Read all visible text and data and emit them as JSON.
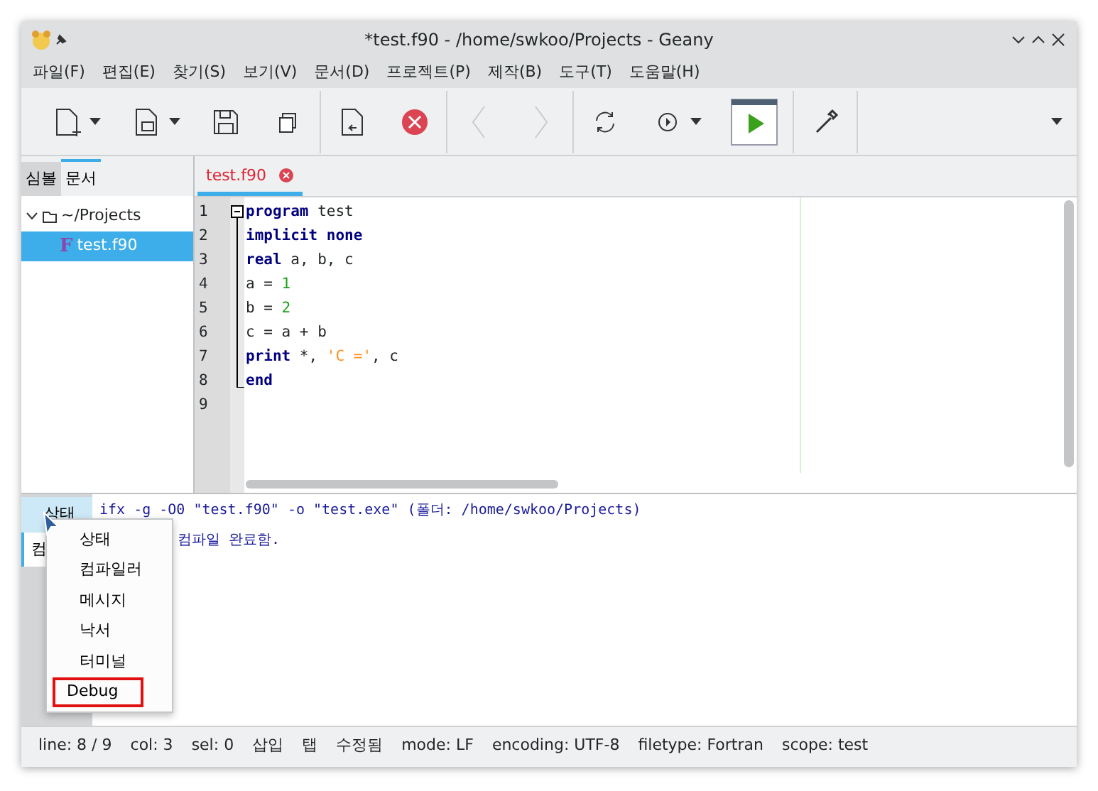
{
  "window": {
    "title": "*test.f90 - /home/swkoo/Projects - Geany"
  },
  "menu": [
    "파일(F)",
    "편집(E)",
    "찾기(S)",
    "보기(V)",
    "문서(D)",
    "프로젝트(P)",
    "제작(B)",
    "도구(T)",
    "도움말(H)"
  ],
  "toolbar": [
    {
      "kind": "new",
      "dropdown": true
    },
    {
      "kind": "open",
      "dropdown": true
    },
    {
      "kind": "save"
    },
    {
      "kind": "saveall"
    },
    {
      "kind": "separator"
    },
    {
      "kind": "revert"
    },
    {
      "kind": "close"
    },
    {
      "kind": "separator"
    },
    {
      "kind": "back",
      "disabled": true
    },
    {
      "kind": "forward",
      "disabled": true
    },
    {
      "kind": "separator"
    },
    {
      "kind": "reload"
    },
    {
      "kind": "execute",
      "dropdown": true
    },
    {
      "kind": "run"
    },
    {
      "kind": "separator"
    },
    {
      "kind": "picker"
    },
    {
      "kind": "separator"
    }
  ],
  "sidebar": {
    "tabs": [
      {
        "label": "심볼",
        "selected": false
      },
      {
        "label": "문서",
        "selected": true
      }
    ],
    "tree": [
      {
        "label": "~/Projects",
        "expanded": true,
        "selected": false,
        "children": [
          {
            "label": "test.f90",
            "badge": "F",
            "selected": true
          }
        ]
      }
    ]
  },
  "editor": {
    "tabs": [
      {
        "label": "test.f90",
        "modified": true,
        "selected": true
      }
    ],
    "lines": [
      {
        "number": "1",
        "tokens": [
          {
            "kind": "keyword",
            "text": "program"
          },
          {
            "kind": "plain",
            "text": " test"
          }
        ]
      },
      {
        "number": "2",
        "tokens": [
          {
            "kind": "keyword",
            "text": "implicit none"
          }
        ]
      },
      {
        "number": "3",
        "tokens": [
          {
            "kind": "keyword",
            "text": "real"
          },
          {
            "kind": "plain",
            "text": " a, b, c"
          }
        ]
      },
      {
        "number": "4",
        "tokens": [
          {
            "kind": "plain",
            "text": "a = "
          },
          {
            "kind": "number",
            "text": "1"
          }
        ]
      },
      {
        "number": "5",
        "tokens": [
          {
            "kind": "plain",
            "text": "b = "
          },
          {
            "kind": "number",
            "text": "2"
          }
        ]
      },
      {
        "number": "6",
        "tokens": [
          {
            "kind": "plain",
            "text": "c = a + b"
          }
        ]
      },
      {
        "number": "7",
        "tokens": [
          {
            "kind": "keyword",
            "text": "print"
          },
          {
            "kind": "plain",
            "text": " *, "
          },
          {
            "kind": "string",
            "text": "'C ='"
          },
          {
            "kind": "plain",
            "text": ", c"
          }
        ]
      },
      {
        "number": "8",
        "tokens": [
          {
            "kind": "keyword",
            "text": "end"
          }
        ]
      },
      {
        "number": "9"
      }
    ]
  },
  "messages": {
    "tabs": [
      {
        "label": "상태",
        "selected": false,
        "hovered": true
      },
      {
        "label": "컴",
        "selected": true,
        "hovered": false
      }
    ],
    "lines": [
      {
        "text": "ifx -g -O0 \"test.f90\" -o \"test.exe\" (폴더: /home/swkoo/Projects)",
        "indented": false
      },
      {
        "text": "컴파일 완료함.",
        "indented": true
      }
    ]
  },
  "popup_menu": [
    {
      "label": "상태",
      "highlighted": false
    },
    {
      "label": "컴파일러",
      "highlighted": false
    },
    {
      "label": "메시지",
      "highlighted": false
    },
    {
      "label": "낙서",
      "highlighted": false
    },
    {
      "label": "터미널",
      "highlighted": false
    },
    {
      "label": "Debug",
      "highlighted": true
    }
  ],
  "status_bar": [
    "line: 8 / 9",
    "col: 3",
    "sel: 0",
    "삽입",
    "탭",
    "수정됨",
    "mode: LF",
    "encoding: UTF-8",
    "filetype: Fortran",
    "scope: test"
  ]
}
